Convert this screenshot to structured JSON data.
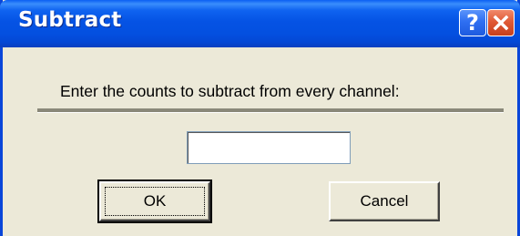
{
  "window": {
    "title": "Subtract",
    "help_label": "?",
    "close_icon": "close-icon"
  },
  "dialog": {
    "prompt": "Enter the counts to subtract from every channel:",
    "input_value": "",
    "ok_label": "OK",
    "cancel_label": "Cancel"
  },
  "colors": {
    "titlebar": "#0553e4",
    "close_button": "#e05a36",
    "face": "#ece9d8"
  }
}
